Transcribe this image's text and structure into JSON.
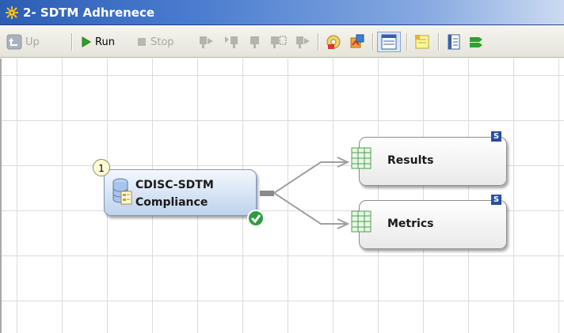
{
  "window": {
    "title": "2- SDTM Adhrenece",
    "title_icon": "gear-burst-icon"
  },
  "toolbar": {
    "up_label": "Up",
    "run_label": "Run",
    "stop_label": "Stop",
    "icons": [
      "up-icon",
      "run-icon",
      "stop-icon",
      "run-from-icon",
      "run-to-icon",
      "step-icon",
      "run-selected-icon",
      "stop-selected-icon",
      "properties-icon",
      "code-icon",
      "grid-icon",
      "note-icon",
      "log-icon",
      "output-icon"
    ]
  },
  "flow": {
    "source_node": {
      "line1": "CDISC-SDTM",
      "line2": "Compliance",
      "sequence": "1",
      "status": "success"
    },
    "output_nodes": [
      {
        "label": "Results",
        "badge": "S"
      },
      {
        "label": "Metrics",
        "badge": "S"
      }
    ]
  },
  "colors": {
    "title_bar": "#2c5db3",
    "node_source_fill": "#bed2ec",
    "badge": "#2a4fa1",
    "success": "#2f9d3f",
    "run": "#2fa02f"
  }
}
